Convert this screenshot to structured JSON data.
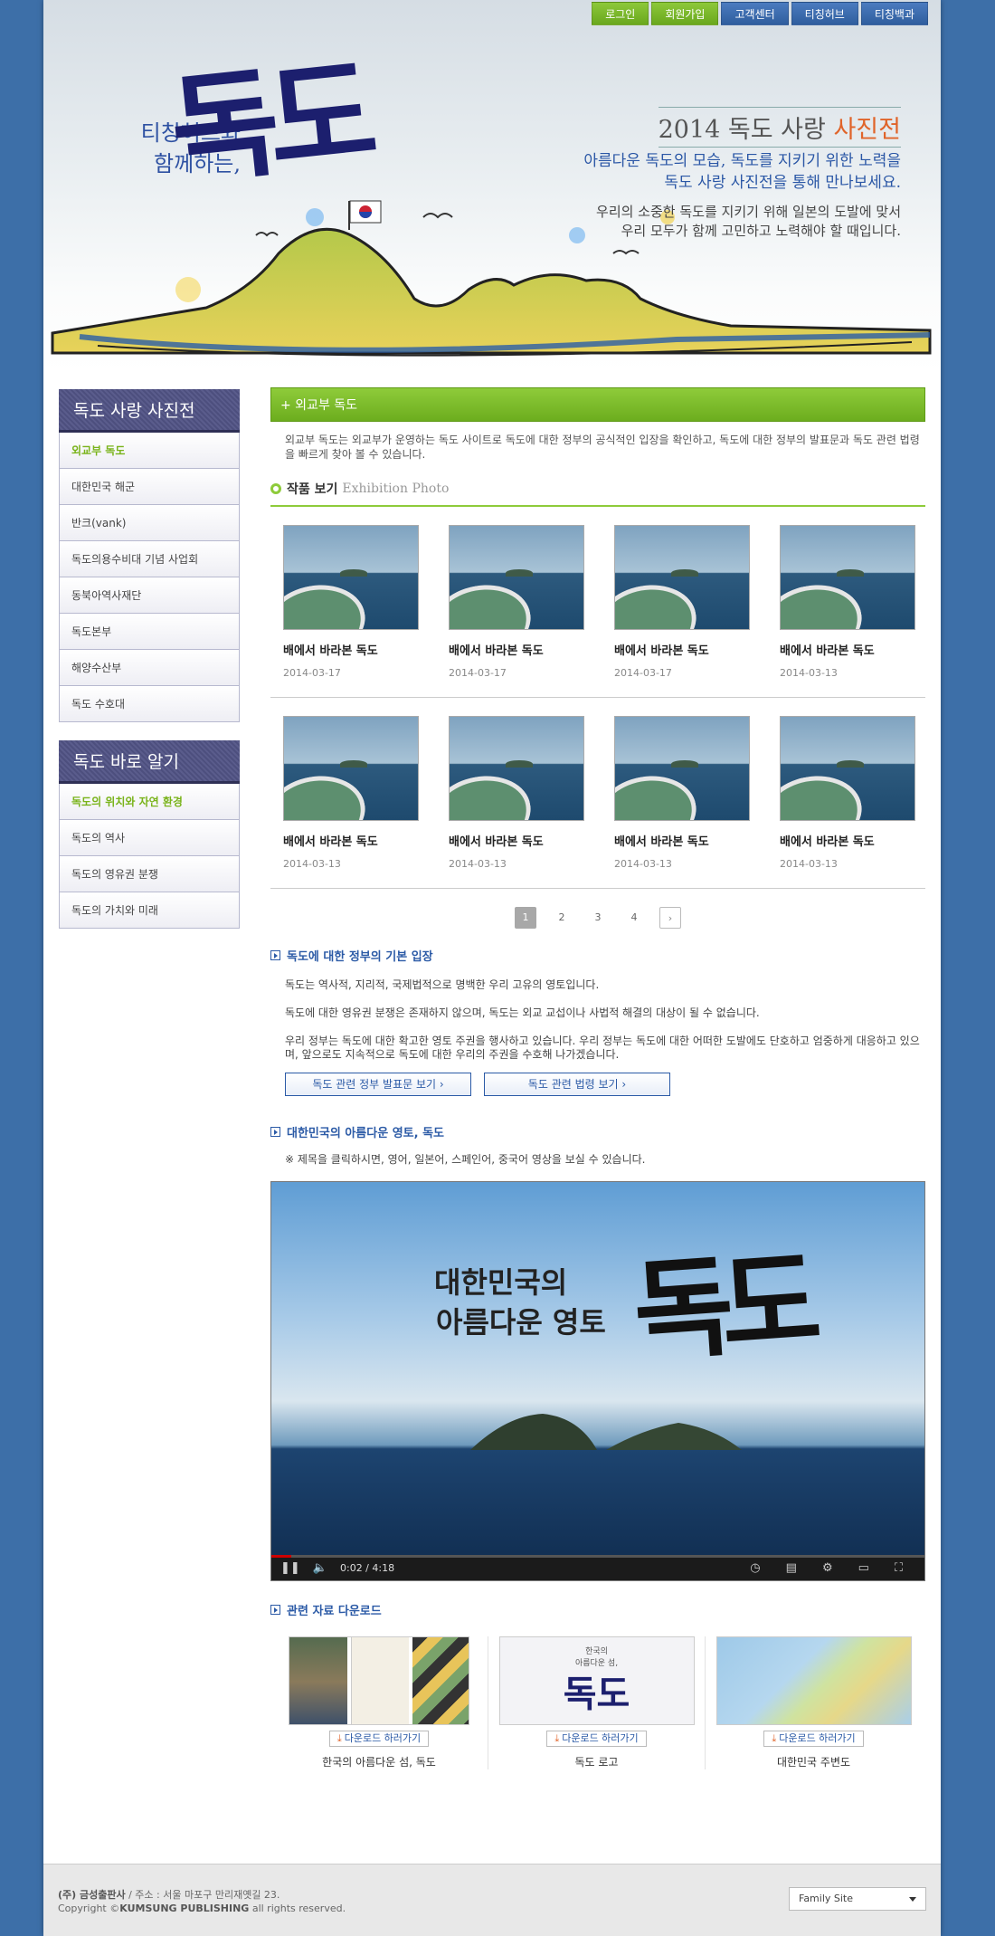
{
  "topnav": [
    "로그인",
    "회원가입",
    "고객센터",
    "티칭허브",
    "티칭백과"
  ],
  "header": {
    "brand_small": "티칭허브와\n함께하는,",
    "brand_big": "독도",
    "title_main": "2014 독도 사랑",
    "title_accent": "사진전",
    "sub": "아름다운 독도의 모습, 독도를 지키기 위한 노력을\n독도 사랑 사진전을 통해 만나보세요.",
    "desc": "우리의 소중한 독도를 지키기 위해 일본의 도발에 맞서\n우리 모두가 함께 고민하고 노력해야 할 때입니다."
  },
  "sidebar": {
    "box1": {
      "title": "독도 사랑 사진전",
      "items": [
        "외교부 독도",
        "대한민국 해군",
        "반크(vank)",
        "독도의용수비대 기념 사업회",
        "동북아역사재단",
        "독도본부",
        "해양수산부",
        "독도 수호대"
      ]
    },
    "box2": {
      "title": "독도 바로 알기",
      "items": [
        "독도의 위치와 자연 환경",
        "독도의 역사",
        "독도의 영유권 분쟁",
        "독도의 가치와 미래"
      ]
    }
  },
  "main": {
    "section_title": "+ 외교부 독도",
    "intro": "외교부 독도는 외교부가 운영하는 독도 사이트로 독도에 대한 정부의 공식적인 입장을 확인하고, 독도에 대한 정부의 발표문과 독도 관련 법령을 빠르게 찾아 볼 수 있습니다.",
    "exhibit_ko": "작품 보기",
    "exhibit_en": "Exhibition Photo",
    "gallery_row1": [
      {
        "caption": "배에서 바라본 독도",
        "date": "2014-03-17"
      },
      {
        "caption": "배에서 바라본 독도",
        "date": "2014-03-17"
      },
      {
        "caption": "배에서 바라본 독도",
        "date": "2014-03-17"
      },
      {
        "caption": "배에서 바라본 독도",
        "date": "2014-03-13"
      }
    ],
    "gallery_row2": [
      {
        "caption": "배에서 바라본 독도",
        "date": "2014-03-13"
      },
      {
        "caption": "배에서 바라본 독도",
        "date": "2014-03-13"
      },
      {
        "caption": "배에서 바라본 독도",
        "date": "2014-03-13"
      },
      {
        "caption": "배에서 바라본 독도",
        "date": "2014-03-13"
      }
    ],
    "pager": [
      "1",
      "2",
      "3",
      "4",
      "›"
    ],
    "gov_head": "독도에 대한 정부의 기본 입장",
    "gov_p1": "독도는 역사적, 지리적, 국제법적으로 명백한 우리 고유의 영토입니다.",
    "gov_p2": "독도에 대한 영유권 분쟁은 존재하지 않으며, 독도는 외교 교섭이나 사법적 해결의 대상이 될 수 없습니다.",
    "gov_p3": "우리 정부는 독도에 대한 확고한 영토 주권을 행사하고 있습니다. 우리 정부는 독도에 대한 어떠한 도발에도 단호하고 엄중하게 대응하고 있으며, 앞으로도 지속적으로 독도에 대한 우리의 주권을 수호해 나가겠습니다.",
    "btn1": "독도 관련 정부 발표문 보기 ›",
    "btn2": "독도 관련 법령 보기 ›",
    "video_head": "대한민국의 아름다운 영토, 독도",
    "video_note": "※ 제목을 클릭하시면, 영어, 일본어, 스페인어, 중국어 영상을 보실 수 있습니다.",
    "video_title1": "대한민국의",
    "video_title2": "아름다운 영토",
    "video_big": "독도",
    "video_time": "0:02 / 4:18",
    "video_progress": 0.03,
    "download_head": "관련 자료 다운로드",
    "download_btn": "다운로드 하러가기",
    "downloads": [
      "한국의 아름다운 섬, 독도",
      "독도 로고",
      "대한민국 주변도"
    ],
    "logo_small": "한국의\n아름다운 섬,",
    "logo_big": "독도"
  },
  "footer": {
    "company": "(주) 금성출판사",
    "address": " / 주소 : 서울 마포구 만리재옛길 23.",
    "copyright_pre": "Copyright ©",
    "copyright_brand": "KUMSUNG PUBLISHING",
    "copyright_post": " all rights reserved.",
    "family_site": "Family Site"
  },
  "colors": {
    "green": "#7dbd28",
    "blue": "#2f5e9e",
    "navy": "#4d4f7e",
    "accent": "#e0642a"
  }
}
